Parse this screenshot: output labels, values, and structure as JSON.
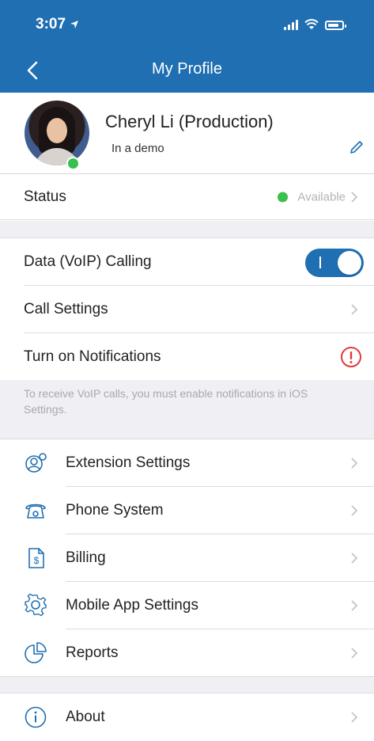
{
  "status_bar": {
    "time": "3:07"
  },
  "nav": {
    "title": "My Profile"
  },
  "profile": {
    "name": "Cheryl Li (Production)",
    "status_message": "In a demo"
  },
  "status_row": {
    "label": "Status",
    "value": "Available",
    "indicator_color": "#3ac04d"
  },
  "settings": {
    "voip_label": "Data (VoIP) Calling",
    "voip_enabled": true,
    "call_settings_label": "Call Settings",
    "notifications_label": "Turn on Notifications"
  },
  "note": "To receive VoIP calls, you must enable notifications in iOS Settings.",
  "menu": {
    "items": [
      {
        "label": "Extension Settings",
        "icon": "extension-settings-icon"
      },
      {
        "label": "Phone System",
        "icon": "phone-icon"
      },
      {
        "label": "Billing",
        "icon": "billing-icon"
      },
      {
        "label": "Mobile App Settings",
        "icon": "gear-icon"
      },
      {
        "label": "Reports",
        "icon": "reports-icon"
      }
    ]
  },
  "about": {
    "label": "About",
    "icon": "info-icon"
  },
  "colors": {
    "accent": "#1f6fb2",
    "warning": "#e03a3a",
    "grouped_background": "#efeff4"
  }
}
